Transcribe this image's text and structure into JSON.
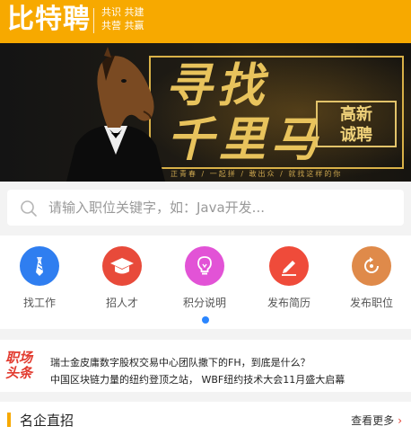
{
  "header": {
    "logo": "比特聘",
    "slogan_line1": "共识 共建",
    "slogan_line2": "共营 共赢"
  },
  "banner": {
    "headline_1": "寻找",
    "headline_2": "千里马",
    "badge_line1": "高新",
    "badge_line2": "诚聘",
    "tagline": "正青春 / 一起拼 / 敢出众 / 就找这样的你"
  },
  "search": {
    "placeholder": "请输入职位关键字，如：Java开发..."
  },
  "nav": {
    "items": [
      {
        "label": "找工作",
        "icon": "tie-icon",
        "color": "#2f7ef0"
      },
      {
        "label": "招人才",
        "icon": "graduation-cap-icon",
        "color": "#e84a3a"
      },
      {
        "label": "积分说明",
        "icon": "lightbulb-icon",
        "color": "#e253d6"
      },
      {
        "label": "发布简历",
        "icon": "edit-icon",
        "color": "#ef4b3a"
      },
      {
        "label": "发布职位",
        "icon": "refresh-icon",
        "color": "#df8a4a"
      }
    ],
    "page_indicator_active": 1,
    "page_indicator_count": 1
  },
  "news": {
    "label_line1": "职场",
    "label_line2": "头条",
    "items": [
      "瑞士金皮庸数字股权交易中心团队撒下的FH，到底是什么？",
      "中国区块链力量的纽约登顶之站， WBF纽约技术大会11月盛大启幕"
    ]
  },
  "section": {
    "title": "名企直招",
    "more": "查看更多"
  },
  "colors": {
    "brand": "#f7a900",
    "accent_red": "#e23b2f",
    "indicator": "#2b86ff"
  }
}
